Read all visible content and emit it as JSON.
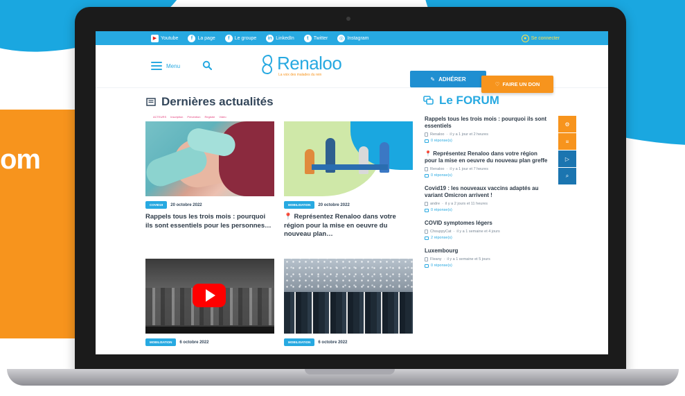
{
  "background": {
    "side_text": "om"
  },
  "topbar": {
    "socials": [
      {
        "icon": "youtube-icon",
        "glyph": "▶",
        "label": "Youtube"
      },
      {
        "icon": "facebook-icon",
        "glyph": "f",
        "label": "La page"
      },
      {
        "icon": "facebook-group-icon",
        "glyph": "f",
        "label": "Le groupe"
      },
      {
        "icon": "linkedin-icon",
        "glyph": "in",
        "label": "LinkedIn"
      },
      {
        "icon": "twitter-icon",
        "glyph": "t",
        "label": "Twitter"
      },
      {
        "icon": "instagram-icon",
        "glyph": "◎",
        "label": "Instagram"
      }
    ],
    "login_label": "Se connecter"
  },
  "header": {
    "menu_label": "Menu",
    "logo_name": "Renaloo",
    "logo_tagline": "La voix des malades du rein",
    "adherer_label": "ADHÉRER",
    "don_label": "FAIRE UN DON"
  },
  "news": {
    "title": "Dernières actualités",
    "categories": [
      "ACTEURS",
      "Inscription",
      "Prévention",
      "Registre",
      "Vidéo"
    ],
    "cards": [
      {
        "tag": "COVID19",
        "date": "20 octobre 2022",
        "title": "Rappels tous les trois mois : pourquoi ils sont essentiels pour les personnes…"
      },
      {
        "tag": "MOBILISATION",
        "date": "20 octobre 2022",
        "title": "Représentez Renaloo dans votre région pour la mise en oeuvre du nouveau plan…",
        "pin": "📍"
      },
      {
        "tag": "MOBILISATION",
        "date": "6 octobre 2022",
        "title": ""
      },
      {
        "tag": "MOBILISATION",
        "date": "6 octobre 2022",
        "title": ""
      }
    ]
  },
  "forum": {
    "title": "Le FORUM",
    "items": [
      {
        "title": "Rappels tous les trois mois : pourquoi ils sont essentiels",
        "author": "Renaloo",
        "ago": "il y a 1 jour et 2 heures",
        "replies": "0 réponse(s)"
      },
      {
        "title": "Représentez Renaloo dans votre région pour la mise en oeuvre du nouveau plan greffe",
        "pin": "📍",
        "author": "Renaloo",
        "ago": "il y a 1 jour et 7 heures",
        "replies": "0 réponse(s)"
      },
      {
        "title": "Covid19 : les nouveaux vaccins adaptés au variant Omicron arrivent !",
        "author": "andre",
        "ago": "il y a 2 jours et 11 heures",
        "replies": "0 réponse(s)"
      },
      {
        "title": "COVID symptomes légers",
        "author": "ChouppyCat",
        "ago": "il y a 1 semaine et 4 jours",
        "replies": "2 réponse(s)"
      },
      {
        "title": "Luxembourg",
        "author": "Fleany",
        "ago": "il y a 1 semaine et 5 jours",
        "replies": "0 réponse(s)"
      }
    ]
  },
  "widgets": [
    "⚙",
    "≡",
    "▷",
    "⌕"
  ],
  "colors": {
    "brand_blue": "#27a9e1",
    "brand_orange": "#f7941d",
    "text_dark": "#2d3a47"
  }
}
